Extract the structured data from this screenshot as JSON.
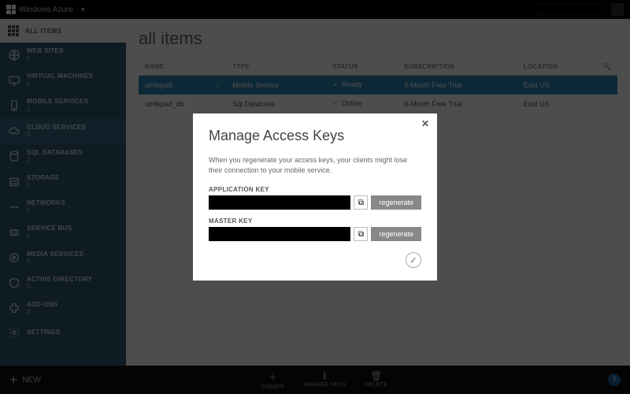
{
  "topbar": {
    "product": "Windows Azure"
  },
  "sidebar": {
    "all_items": "ALL ITEMS",
    "items": [
      {
        "label": "WEB SITES",
        "count": "0"
      },
      {
        "label": "VIRTUAL MACHINES",
        "count": "0"
      },
      {
        "label": "MOBILE SERVICES",
        "count": "1"
      },
      {
        "label": "CLOUD SERVICES",
        "count": "0"
      },
      {
        "label": "SQL DATABASES",
        "count": "1"
      },
      {
        "label": "STORAGE",
        "count": "0"
      },
      {
        "label": "NETWORKS",
        "count": "0"
      },
      {
        "label": "SERVICE BUS",
        "count": "0"
      },
      {
        "label": "MEDIA SERVICES",
        "count": "0"
      },
      {
        "label": "ACTIVE DIRECTORY",
        "count": "0"
      },
      {
        "label": "ADD-ONS",
        "count": "0"
      },
      {
        "label": "SETTINGS",
        "count": ""
      }
    ]
  },
  "content": {
    "heading": "all items",
    "columns": {
      "name": "NAME",
      "type": "TYPE",
      "status": "STATUS",
      "subscription": "SUBSCRIPTION",
      "location": "LOCATION"
    },
    "rows": [
      {
        "name": "strifepad",
        "type": "Mobile Service",
        "status": "Ready",
        "subscription": "3-Month Free Trial",
        "location": "East US"
      },
      {
        "name": "strifepad_db",
        "type": "Sql Database",
        "status": "Online",
        "subscription": "3-Month Free Trial",
        "location": "East US"
      }
    ]
  },
  "bottombar": {
    "new": "NEW",
    "actions": {
      "create": "CREATE",
      "manage_keys": "MANAGE KEYS",
      "delete": "DELETE"
    }
  },
  "modal": {
    "title": "Manage Access Keys",
    "desc": "When you regenerate your access keys, your clients might lose their connection to your mobile service.",
    "app_key_label": "APPLICATION KEY",
    "master_key_label": "MASTER KEY",
    "app_key_value": "",
    "master_key_value": "",
    "regenerate": "regenerate"
  }
}
